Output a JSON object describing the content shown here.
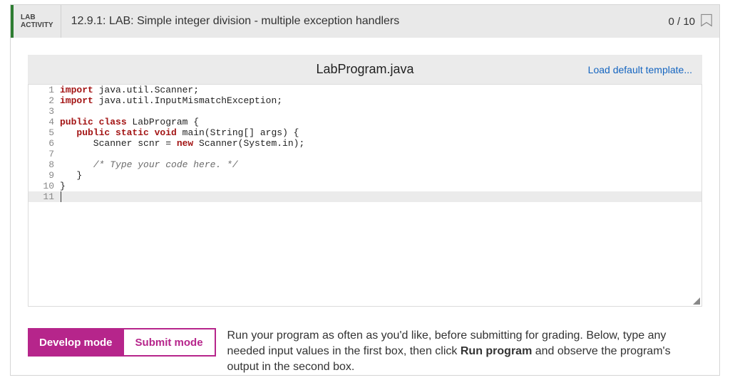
{
  "header": {
    "label_line1": "LAB",
    "label_line2": "ACTIVITY",
    "title": "12.9.1: LAB: Simple integer division - multiple exception handlers",
    "score": "0 / 10"
  },
  "filebar": {
    "filename": "LabProgram.java",
    "load_default": "Load default template..."
  },
  "code_lines": [
    {
      "n": "1",
      "tokens": [
        {
          "t": "import",
          "c": "kw"
        },
        {
          "t": " java.util.Scanner;"
        }
      ]
    },
    {
      "n": "2",
      "tokens": [
        {
          "t": "import",
          "c": "kw"
        },
        {
          "t": " java.util.InputMismatchException;"
        }
      ]
    },
    {
      "n": "3",
      "tokens": []
    },
    {
      "n": "4",
      "tokens": [
        {
          "t": "public class",
          "c": "kw"
        },
        {
          "t": " LabProgram {"
        }
      ]
    },
    {
      "n": "5",
      "tokens": [
        {
          "t": "   "
        },
        {
          "t": "public static void",
          "c": "kw"
        },
        {
          "t": " main(String[] args) {"
        }
      ]
    },
    {
      "n": "6",
      "tokens": [
        {
          "t": "      Scanner scnr = "
        },
        {
          "t": "new",
          "c": "kw"
        },
        {
          "t": " Scanner(System.in);"
        }
      ]
    },
    {
      "n": "7",
      "tokens": []
    },
    {
      "n": "8",
      "tokens": [
        {
          "t": "      "
        },
        {
          "t": "/* Type your code here. */",
          "c": "cm"
        }
      ]
    },
    {
      "n": "9",
      "tokens": [
        {
          "t": "   }"
        }
      ]
    },
    {
      "n": "10",
      "tokens": [
        {
          "t": "}"
        }
      ]
    },
    {
      "n": "11",
      "tokens": [],
      "hl": true,
      "cursor": true
    }
  ],
  "modes": {
    "develop": "Develop mode",
    "submit": "Submit mode",
    "help_pre": "Run your program as often as you'd like, before submitting for grading. Below, type any needed input values in the first box, then click ",
    "help_bold": "Run program",
    "help_post": " and observe the program's output in the second box."
  }
}
